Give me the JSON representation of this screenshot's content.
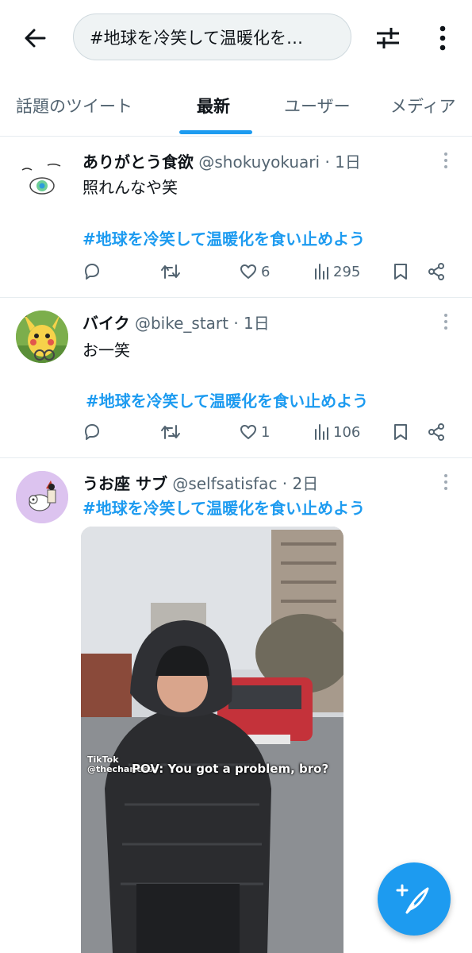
{
  "header": {
    "search_query": "#地球を冷笑して温暖化を…",
    "back_icon": "arrow-left-icon",
    "filter_icon": "sliders-icon",
    "more_icon": "more-vertical-icon"
  },
  "tabs": [
    {
      "label": "話題のツイート",
      "active": false
    },
    {
      "label": "最新",
      "active": true
    },
    {
      "label": "ユーザー",
      "active": false
    },
    {
      "label": "メディア",
      "active": false
    }
  ],
  "tweets": [
    {
      "name": "ありがとう食欲",
      "handle": "@shokuyokuari",
      "time": "· 1日",
      "text": "照れんなや笑",
      "hashtag": "#地球を冷笑して温暖化を食い止めよう",
      "likes": "6",
      "views": "295"
    },
    {
      "name": "バイク",
      "handle": "@bike_start",
      "time": "· 1日",
      "text": "お一笑",
      "hashtag": "#地球を冷笑して温暖化を食い止めよう",
      "likes": "1",
      "views": "106"
    },
    {
      "name": "うお座 サブ",
      "handle": "@selfsatisfac",
      "time": "· 2日",
      "hashtag": "#地球を冷笑して温暖化を食い止めよう",
      "media": {
        "caption": "POV: You got a problem, bro?",
        "watermark_app": "TikTok",
        "watermark_user": "@thecharlessy"
      }
    }
  ],
  "colors": {
    "accent": "#1d9bf0",
    "text": "#0f1419",
    "secondary": "#536471"
  },
  "fab": {
    "icon": "compose-feather-icon"
  }
}
